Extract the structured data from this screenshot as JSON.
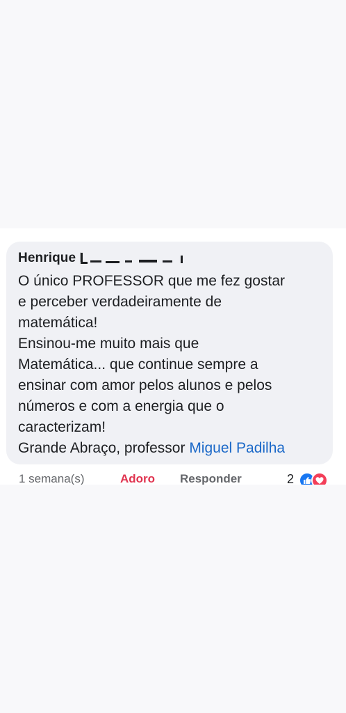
{
  "comment": {
    "author": "Henrique L",
    "author_tail": "o",
    "lines": [
      "O único PROFESSOR que me fez gostar",
      "e perceber verdadeiramente de",
      "matemática!",
      "Ensinou-me muito mais que",
      "Matemática... que continue sempre a",
      "ensinar com amor pelos alunos e pelos",
      "números e com a energia que o",
      "caracterizam!"
    ],
    "closing_prefix": "Grande Abraço, professor ",
    "mention": "Miguel Padilha"
  },
  "actions": {
    "time": "1 semana(s)",
    "reaction_label": "Adoro",
    "reply_label": "Responder",
    "reaction_count": "2"
  },
  "icons": {
    "like": "thumbs-up-icon",
    "love": "heart-icon"
  },
  "colors": {
    "mention": "#1a68c8",
    "love": "#e0334f",
    "like_badge": "#1877f2",
    "heart_badge": "#f33e58"
  }
}
